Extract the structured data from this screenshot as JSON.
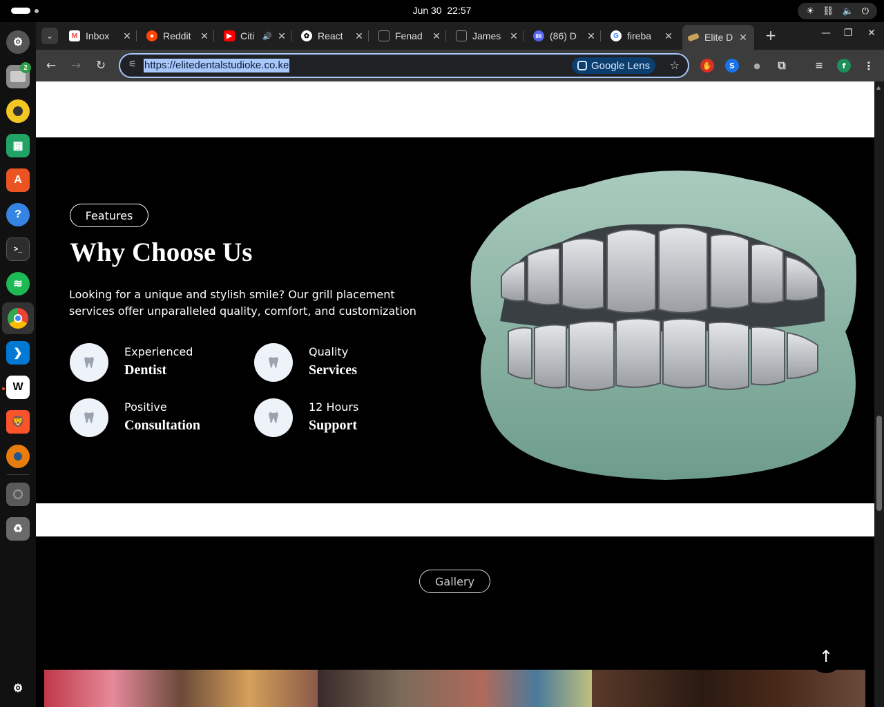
{
  "system": {
    "date": "Jun 30",
    "time": "22:57",
    "tray_icons": [
      "brightness-icon",
      "network-icon",
      "volume-icon",
      "power-icon"
    ]
  },
  "dock": {
    "apps": [
      {
        "name": "settings-app",
        "label": ""
      },
      {
        "name": "files-app",
        "label": "",
        "badge": "2"
      },
      {
        "name": "rhythmbox-app",
        "label": ""
      },
      {
        "name": "spreadsheet-app",
        "label": ""
      },
      {
        "name": "app-center",
        "label": ""
      },
      {
        "name": "help-app",
        "label": "?"
      },
      {
        "name": "terminal-app",
        "label": ">_"
      },
      {
        "name": "spotify-app",
        "label": ""
      },
      {
        "name": "chrome-app",
        "label": ""
      },
      {
        "name": "vscode-app",
        "label": ""
      },
      {
        "name": "webstorm-app",
        "label": "W"
      },
      {
        "name": "brave-app",
        "label": ""
      },
      {
        "name": "blender-app",
        "label": ""
      },
      {
        "name": "disk-app",
        "label": ""
      },
      {
        "name": "trash-app",
        "label": ""
      }
    ]
  },
  "browser": {
    "tabs": [
      {
        "title": "Inbox",
        "favicon": "gmail-icon",
        "color": "#ea4335"
      },
      {
        "title": "Reddit",
        "favicon": "reddit-icon",
        "color": "#ff4500"
      },
      {
        "title": "Citi",
        "favicon": "youtube-icon",
        "color": "#ff0000",
        "audio": true
      },
      {
        "title": "React",
        "favicon": "openai-icon",
        "color": "#444444"
      },
      {
        "title": "Fenad",
        "favicon": "page-icon",
        "color": "#555555"
      },
      {
        "title": "James",
        "favicon": "page-icon",
        "color": "#555555"
      },
      {
        "title": "(86) D",
        "favicon": "discord-icon",
        "color": "#5865f2",
        "badge": "86"
      },
      {
        "title": "fireba",
        "favicon": "google-icon",
        "color": "#4285f4"
      },
      {
        "title": "Elite D",
        "favicon": "grill-favicon",
        "color": "#c8a15a",
        "active": true
      }
    ],
    "url": "https://elitedentalstudioke.co.ke",
    "lens_label": "Google Lens",
    "profile_initial": "f"
  },
  "page": {
    "features_tag": "Features",
    "heading": "Why Choose Us",
    "lead": "Looking for a unique and stylish smile? Our grill placement services offer unparalleled quality, comfort, and customization",
    "features": [
      {
        "small": "Experienced",
        "big": "Dentist"
      },
      {
        "small": "Quality",
        "big": "Services"
      },
      {
        "small": "Positive",
        "big": "Consultation"
      },
      {
        "small": "12 Hours",
        "big": "Support"
      }
    ],
    "gallery_tag": "Gallery",
    "scroll_top_icon": "arrow-up-icon"
  }
}
